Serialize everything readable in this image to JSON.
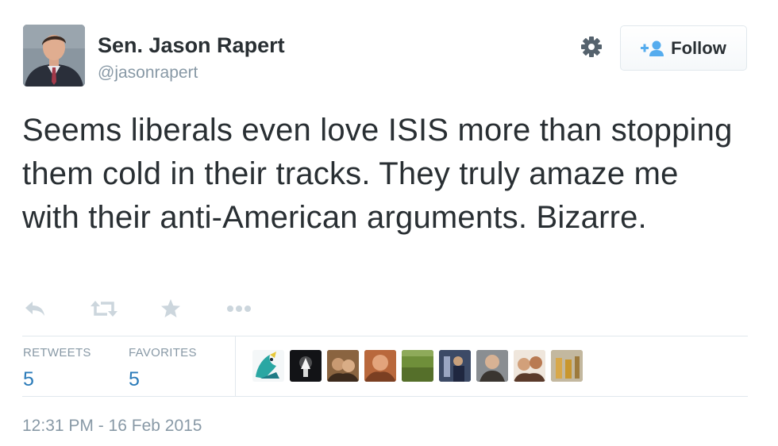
{
  "user": {
    "display_name": "Sen. Jason Rapert",
    "screen_name": "@jasonrapert"
  },
  "follow_button": {
    "label": "Follow",
    "icon": "add-user-icon"
  },
  "settings_icon": "gear-icon",
  "tweet": {
    "text": "Seems liberals even love ISIS more than stopping them cold in their tracks. They truly amaze me with their anti-American arguments. Bizarre."
  },
  "actions": [
    "reply-icon",
    "retweet-icon",
    "favorite-icon",
    "more-icon"
  ],
  "stats": {
    "retweets": {
      "label": "RETWEETS",
      "count": "5"
    },
    "favorites": {
      "label": "FAVORITES",
      "count": "5"
    }
  },
  "favorited_by_avatars": 9,
  "timestamp": "12:31 PM - 16 Feb 2015",
  "colors": {
    "text": "#292f33",
    "muted": "#8899a6",
    "count_blue": "#2b7bb9",
    "border": "#e1e8ed",
    "action_icon": "#ccd6dd"
  }
}
